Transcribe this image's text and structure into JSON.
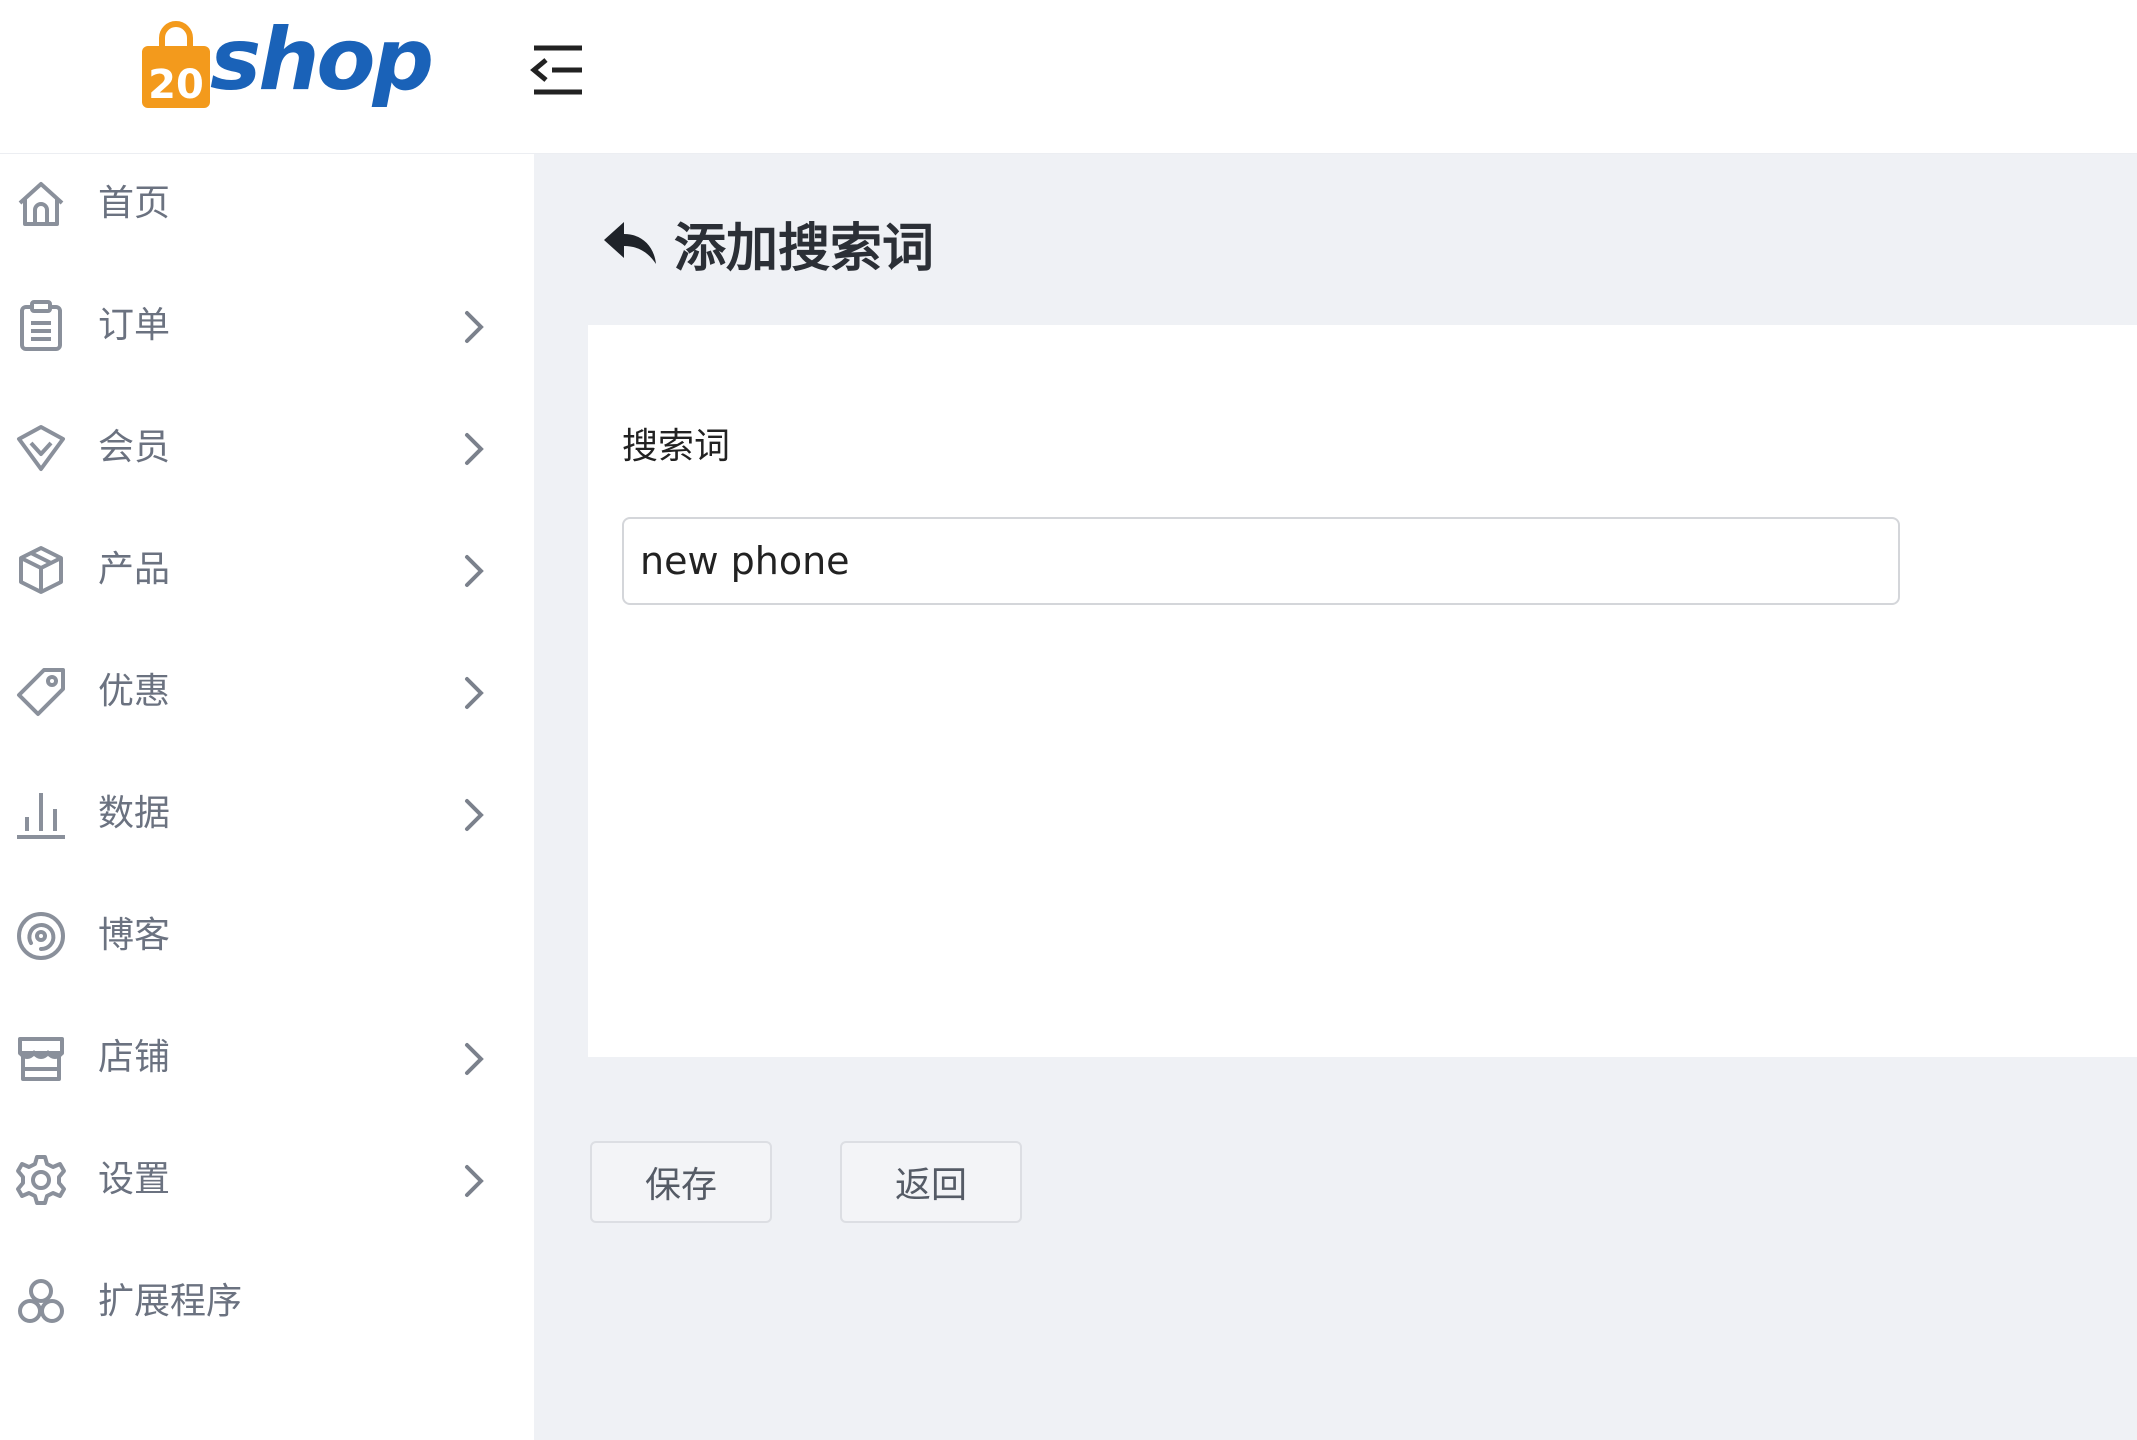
{
  "header": {
    "logo_text": "shop",
    "logo_badge": "20"
  },
  "sidebar": {
    "items": [
      {
        "label": "首页",
        "icon": "home-icon",
        "has_submenu": false
      },
      {
        "label": "订单",
        "icon": "clipboard-icon",
        "has_submenu": true
      },
      {
        "label": "会员",
        "icon": "heart-shield-icon",
        "has_submenu": true
      },
      {
        "label": "产品",
        "icon": "box-icon",
        "has_submenu": true
      },
      {
        "label": "优惠",
        "icon": "tag-icon",
        "has_submenu": true
      },
      {
        "label": "数据",
        "icon": "bar-chart-icon",
        "has_submenu": true
      },
      {
        "label": "博客",
        "icon": "target-icon",
        "has_submenu": false
      },
      {
        "label": "店铺",
        "icon": "store-icon",
        "has_submenu": true
      },
      {
        "label": "设置",
        "icon": "gear-icon",
        "has_submenu": true
      },
      {
        "label": "扩展程序",
        "icon": "extensions-icon",
        "has_submenu": false
      }
    ]
  },
  "page": {
    "title": "添加搜索词"
  },
  "form": {
    "keyword_label": "搜索词",
    "keyword_value": "new phone"
  },
  "actions": {
    "save_label": "保存",
    "back_label": "返回"
  },
  "colors": {
    "logo_orange": "#f39a1c",
    "logo_blue": "#1a62b8",
    "sidebar_text": "#6b7280",
    "content_bg": "#eff1f5"
  }
}
